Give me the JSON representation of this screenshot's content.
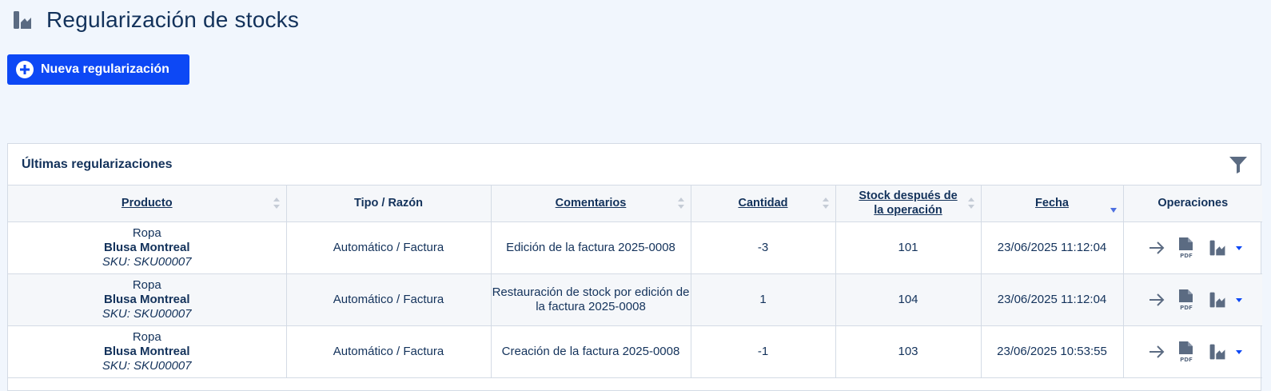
{
  "header": {
    "title": "Regularización de stocks",
    "icon": "stock-icon"
  },
  "actions": {
    "new_label": "Nueva regularización"
  },
  "card": {
    "title": "Últimas regularizaciones"
  },
  "table": {
    "columns": [
      {
        "label": "Producto",
        "sortable": true
      },
      {
        "label": "Tipo / Razón",
        "sortable": false
      },
      {
        "label": "Comentarios",
        "sortable": true
      },
      {
        "label": "Cantidad",
        "sortable": true
      },
      {
        "label": "Stock después de la operación",
        "sortable": true
      },
      {
        "label": "Fecha",
        "sortable": true,
        "sorted": "desc"
      },
      {
        "label": "Operaciones",
        "sortable": false
      }
    ],
    "rows": [
      {
        "category": "Ropa",
        "name": "Blusa Montreal",
        "sku": "SKU: SKU00007",
        "type": "Automático / Factura",
        "comment": "Edición de la factura 2025-0008",
        "quantity": "-3",
        "stock_after": "101",
        "date": "23/06/2025 11:12:04"
      },
      {
        "category": "Ropa",
        "name": "Blusa Montreal",
        "sku": "SKU: SKU00007",
        "type": "Automático / Factura",
        "comment": "Restauración de stock por edición de la factura 2025-0008",
        "quantity": "1",
        "stock_after": "104",
        "date": "23/06/2025 11:12:04"
      },
      {
        "category": "Ropa",
        "name": "Blusa Montreal",
        "sku": "SKU: SKU00007",
        "type": "Automático / Factura",
        "comment": "Creación de la factura 2025-0008",
        "quantity": "-1",
        "stock_after": "103",
        "date": "23/06/2025 10:53:55"
      }
    ]
  },
  "colors": {
    "primary": "#0d48f5",
    "text": "#13325b",
    "background": "#f1f6fd",
    "icon": "#5b6b82",
    "sort_active": "#4d6fe0"
  }
}
